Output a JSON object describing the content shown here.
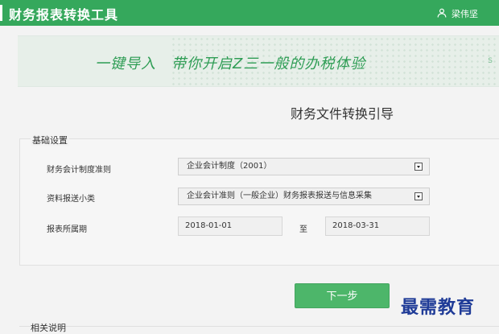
{
  "app": {
    "title": "财务报表转换工具",
    "user_name": "梁伟坚",
    "user_icon": "user-icon"
  },
  "banner": {
    "slogan": "一键导入　带你开启Z三一般的办税体验",
    "corner_mark": "S"
  },
  "page": {
    "title": "财务文件转换引导"
  },
  "basic_settings": {
    "section_title": "基础设置",
    "rows": [
      {
        "label": "财务会计制度准则",
        "value": "企业会计制度（2001）"
      },
      {
        "label": "资料报送小类",
        "value": "企业会计准则（一般企业）财务报表报送与信息采集"
      }
    ],
    "period": {
      "label": "报表所属期",
      "start": "2018-01-01",
      "separator": "至",
      "end": "2018-03-31"
    }
  },
  "actions": {
    "next_label": "下一步"
  },
  "related": {
    "title": "相关说明"
  },
  "watermark": {
    "text": "最需教育"
  },
  "colors": {
    "brand_green": "#35a85c",
    "button_green": "#4db66a",
    "watermark_blue": "#1f3b97"
  }
}
